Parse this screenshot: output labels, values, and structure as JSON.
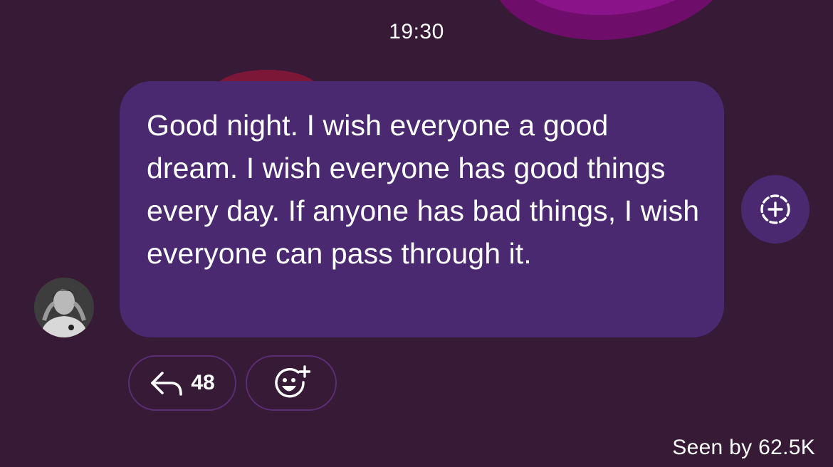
{
  "header": {
    "time": "19:30"
  },
  "message": {
    "text": "Good night. I wish everyone a good dream. I wish everyone has good things every day. If anyone has bad things, I wish everyone can pass through it.",
    "bubble_color": "#4a2971",
    "avatar_icon": "user-avatar"
  },
  "actions": {
    "reply_count": "48",
    "reply_icon": "reply-arrow-icon",
    "react_icon": "add-reaction-icon",
    "add_icon": "dashed-circle-plus-icon"
  },
  "footer": {
    "seen_text": "Seen by 62.5K"
  },
  "colors": {
    "background": "#361a36",
    "pill_border": "#5a2e73"
  }
}
